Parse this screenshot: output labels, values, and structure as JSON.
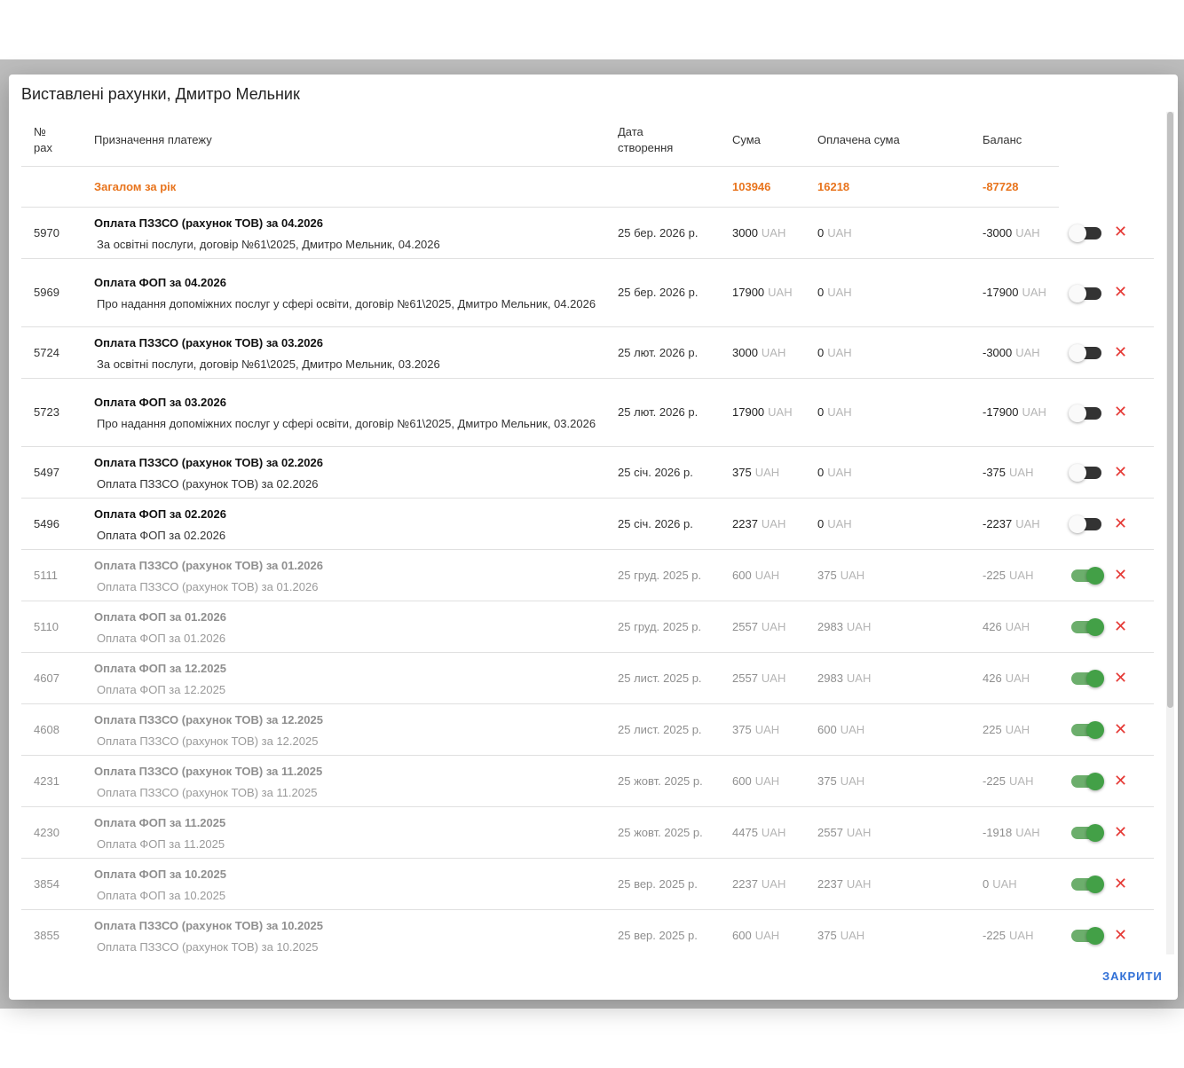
{
  "dialog": {
    "title": "Виставлені рахунки, Дмитро Мельник",
    "close_label": "ЗАКРИТИ"
  },
  "unit": "UAH",
  "table": {
    "headers": {
      "num_line1": "№",
      "num_line2": "рах",
      "purpose": "Призначення платежу",
      "date_line1": "Дата",
      "date_line2": "створення",
      "sum": "Сума",
      "paid": "Оплачена сума",
      "balance": "Баланс"
    },
    "total": {
      "label": "Загалом за рік",
      "sum": "103946",
      "paid": "16218",
      "balance": "-87728"
    },
    "rows": [
      {
        "num": "5970",
        "title": "Оплата ПЗЗСО (рахунок ТОВ) за 04.2026",
        "desc": "За освітні послуги, договір №61\\2025, Дмитро Мельник, 04.2026",
        "date": "25 бер. 2026 р.",
        "sum": "3000",
        "paid": "0",
        "balance": "-3000",
        "active": false
      },
      {
        "num": "5969",
        "title": "Оплата ФОП за 04.2026",
        "desc": "Про надання допоміжних послуг у сфері освіти, договір №61\\2025, Дмитро Мельник, 04.2026",
        "date": "25 бер. 2026 р.",
        "sum": "17900",
        "paid": "0",
        "balance": "-17900",
        "active": false
      },
      {
        "num": "5724",
        "title": "Оплата ПЗЗСО (рахунок ТОВ) за 03.2026",
        "desc": "За освітні послуги, договір №61\\2025, Дмитро Мельник, 03.2026",
        "date": "25 лют. 2026 р.",
        "sum": "3000",
        "paid": "0",
        "balance": "-3000",
        "active": false
      },
      {
        "num": "5723",
        "title": "Оплата ФОП за 03.2026",
        "desc": "Про надання допоміжних послуг у сфері освіти, договір №61\\2025, Дмитро Мельник, 03.2026",
        "date": "25 лют. 2026 р.",
        "sum": "17900",
        "paid": "0",
        "balance": "-17900",
        "active": false
      },
      {
        "num": "5497",
        "title": "Оплата ПЗЗСО (рахунок ТОВ) за 02.2026",
        "desc": "Оплата ПЗЗСО (рахунок ТОВ) за 02.2026",
        "date": "25 січ. 2026 р.",
        "sum": "375",
        "paid": "0",
        "balance": "-375",
        "active": false
      },
      {
        "num": "5496",
        "title": "Оплата ФОП за 02.2026",
        "desc": "Оплата ФОП за 02.2026",
        "date": "25 січ. 2026 р.",
        "sum": "2237",
        "paid": "0",
        "balance": "-2237",
        "active": false
      },
      {
        "num": "5111",
        "title": "Оплата ПЗЗСО (рахунок ТОВ) за 01.2026",
        "desc": "Оплата ПЗЗСО (рахунок ТОВ) за 01.2026",
        "date": "25 груд. 2025 р.",
        "sum": "600",
        "paid": "375",
        "balance": "-225",
        "active": true
      },
      {
        "num": "5110",
        "title": "Оплата ФОП за 01.2026",
        "desc": "Оплата ФОП за 01.2026",
        "date": "25 груд. 2025 р.",
        "sum": "2557",
        "paid": "2983",
        "balance": "426",
        "active": true
      },
      {
        "num": "4607",
        "title": "Оплата ФОП за 12.2025",
        "desc": "Оплата ФОП за 12.2025",
        "date": "25 лист. 2025 р.",
        "sum": "2557",
        "paid": "2983",
        "balance": "426",
        "active": true
      },
      {
        "num": "4608",
        "title": "Оплата ПЗЗСО (рахунок ТОВ) за 12.2025",
        "desc": "Оплата ПЗЗСО (рахунок ТОВ) за 12.2025",
        "date": "25 лист. 2025 р.",
        "sum": "375",
        "paid": "600",
        "balance": "225",
        "active": true
      },
      {
        "num": "4231",
        "title": "Оплата ПЗЗСО (рахунок ТОВ) за 11.2025",
        "desc": "Оплата ПЗЗСО (рахунок ТОВ) за 11.2025",
        "date": "25 жовт. 2025 р.",
        "sum": "600",
        "paid": "375",
        "balance": "-225",
        "active": true
      },
      {
        "num": "4230",
        "title": "Оплата ФОП за 11.2025",
        "desc": "Оплата ФОП за 11.2025",
        "date": "25 жовт. 2025 р.",
        "sum": "4475",
        "paid": "2557",
        "balance": "-1918",
        "active": true
      },
      {
        "num": "3854",
        "title": "Оплата ФОП за 10.2025",
        "desc": "Оплата ФОП за 10.2025",
        "date": "25 вер. 2025 р.",
        "sum": "2237",
        "paid": "2237",
        "balance": "0",
        "active": true
      },
      {
        "num": "3855",
        "title": "Оплата ПЗЗСО (рахунок ТОВ) за 10.2025",
        "desc": "Оплата ПЗЗСО (рахунок ТОВ) за 10.2025",
        "date": "25 вер. 2025 р.",
        "sum": "600",
        "paid": "375",
        "balance": "-225",
        "active": true
      }
    ]
  }
}
